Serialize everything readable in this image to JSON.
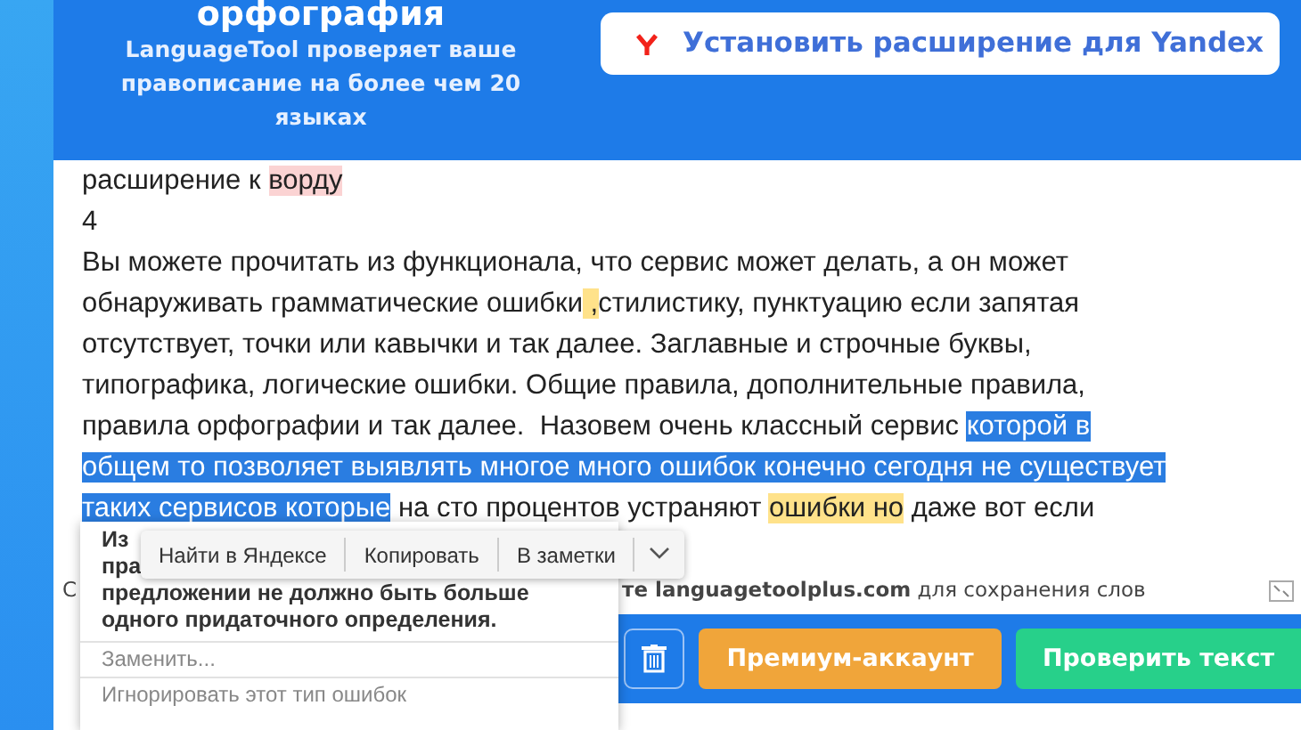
{
  "header": {
    "title": "орфография",
    "subtitle": "LanguageTool проверяет ваше правописание на более чем 20 языках",
    "install_button": "Установить расширение для Yandex"
  },
  "editor": {
    "lines": [
      [
        {
          "text": "расширение к ",
          "kind": "plain"
        },
        {
          "text": "ворду",
          "kind": "error"
        }
      ],
      [
        {
          "text": "4",
          "kind": "plain"
        }
      ],
      [
        {
          "text": "Вы можете прочитать из функционала, что сервис может делать, а он может",
          "kind": "plain"
        }
      ],
      [
        {
          "text": "обнаруживать грамматические ошибки",
          "kind": "plain"
        },
        {
          "text": " ,",
          "kind": "warning"
        },
        {
          "text": "стилистику, пунктуацию если запятая",
          "kind": "plain"
        }
      ],
      [
        {
          "text": "отсутствует, точки или кавычки и так далее. Заглавные и строчные буквы,",
          "kind": "plain"
        }
      ],
      [
        {
          "text": "типографика, логические ошибки. Общие правила, дополнительные правила,",
          "kind": "plain"
        }
      ],
      [
        {
          "text": "правила орфографии и так далее.  Назовем очень классный сервис ",
          "kind": "plain"
        },
        {
          "text": "которой в",
          "kind": "selection"
        }
      ],
      [
        {
          "text": "общем то позволяет выявлять многое много ошибок конечно сегодня не существует",
          "kind": "selection"
        }
      ],
      [
        {
          "text": "таких сервисов которые",
          "kind": "selection"
        },
        {
          "text": " на сто процентов устраняют ",
          "kind": "plain"
        },
        {
          "text": "ошибки но",
          "kind": "warning"
        },
        {
          "text": " даже вот если",
          "kind": "plain"
        }
      ]
    ]
  },
  "status": {
    "lead": "С",
    "text": "**те languagetoolplus.com** для сохранения слов"
  },
  "footer": {
    "buttons": [
      {
        "kind": "trash"
      },
      {
        "kind": "premium",
        "label": "Премиум-аккаунт"
      },
      {
        "kind": "check",
        "label": "Проверить текст"
      }
    ]
  },
  "error_card": {
    "message_lines": [
      "Из",
      "пра",
      "предложении не должно быть больше одного придаточного определения."
    ],
    "replace_placeholder": "Заменить...",
    "ignore": "Игнорировать этот тип ошибок"
  },
  "context_menu": {
    "items": [
      "Найти в Яндексе",
      "Копировать",
      "В заметки"
    ]
  }
}
